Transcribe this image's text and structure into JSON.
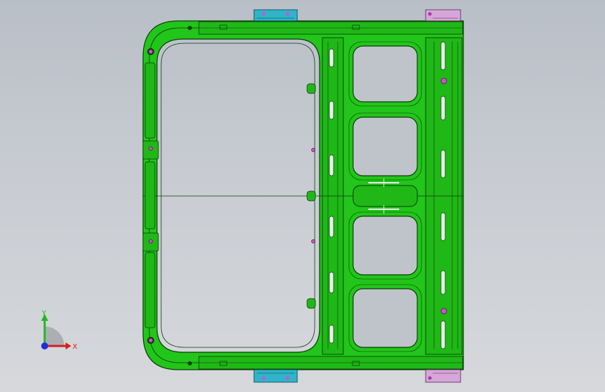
{
  "viewport": {
    "background_top": "#b9bfc7",
    "background_bottom": "#d6d8dc",
    "model_color": "#22c51a",
    "model_edge_color": "#0b3a08",
    "bracket_blue_color": "#2fb4c9",
    "bracket_pink_color": "#d7a6d8",
    "fastener_color": "#d24fd0"
  },
  "triad": {
    "x_label": "X",
    "y_label": "Y",
    "x_color": "#d21e1e",
    "y_color": "#1fb81f",
    "z_color": "#1c2ee0"
  }
}
